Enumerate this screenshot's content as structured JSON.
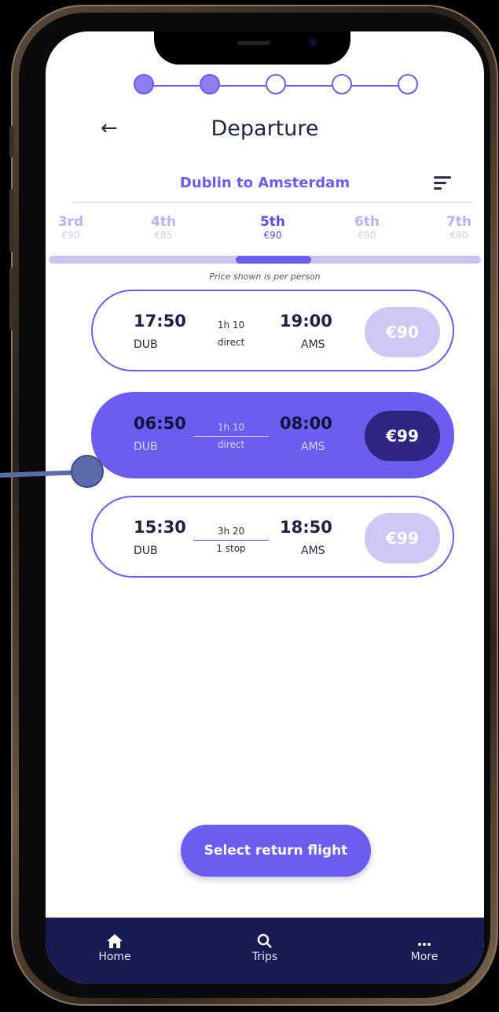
{
  "header": {
    "back_icon": "arrow-left-icon",
    "title": "Departure",
    "steps": [
      {
        "state": "done"
      },
      {
        "state": "done"
      },
      {
        "state": "todo"
      },
      {
        "state": "todo"
      },
      {
        "state": "todo"
      }
    ]
  },
  "route": {
    "label": "Dublin to Amsterdam",
    "sort_icon": "sort-icon"
  },
  "dates": [
    {
      "day": "3rd",
      "price": "€90",
      "active": false
    },
    {
      "day": "4th",
      "price": "€85",
      "active": false
    },
    {
      "day": "5th",
      "price": "€90",
      "active": true
    },
    {
      "day": "6th",
      "price": "€90",
      "active": false
    },
    {
      "day": "7th",
      "price": "€90",
      "active": false
    }
  ],
  "note": "Price shown is per person",
  "flights": [
    {
      "dep_time": "17:50",
      "dep_code": "DUB",
      "duration": "1h 10",
      "stops": "direct",
      "arr_time": "19:00",
      "arr_code": "AMS",
      "price": "€90",
      "selected": false
    },
    {
      "dep_time": "06:50",
      "dep_code": "DUB",
      "duration": "1h 10",
      "stops": "direct",
      "arr_time": "08:00",
      "arr_code": "AMS",
      "price": "€99",
      "selected": true
    },
    {
      "dep_time": "15:30",
      "dep_code": "DUB",
      "duration": "3h 20",
      "stops": "1 stop",
      "arr_time": "18:50",
      "arr_code": "AMS",
      "price": "€99",
      "selected": false
    }
  ],
  "cta": "Select return flight",
  "nav": [
    {
      "label": "Home",
      "icon": "home-icon"
    },
    {
      "label": "Trips",
      "icon": "search-icon"
    },
    {
      "label": "More",
      "icon": "more-icon"
    }
  ],
  "colors": {
    "accent": "#6a5df0",
    "price_light": "#cfc8f7",
    "price_dark": "#2e2482",
    "navbar": "#181a52"
  }
}
